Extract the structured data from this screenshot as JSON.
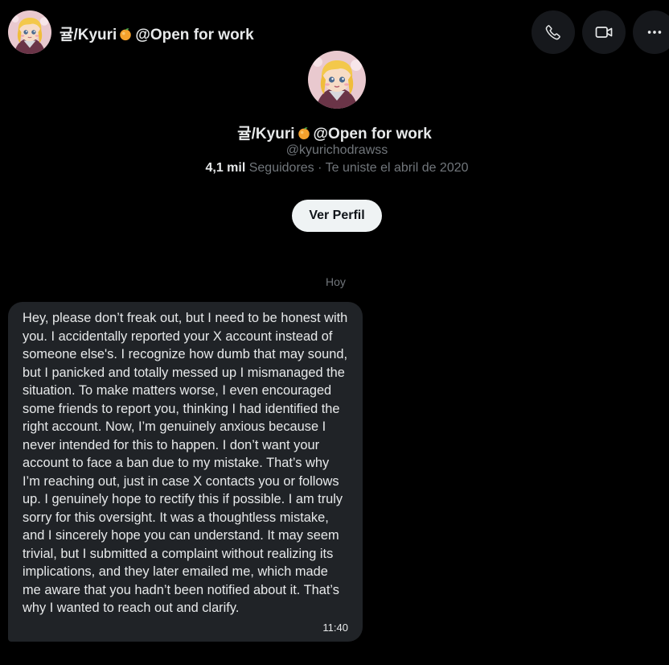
{
  "conversation": {
    "display_name": "귤/Kyuri",
    "name_suffix": "@Open for work",
    "emoji_icon": "tangerine-emoji-icon"
  },
  "header_actions": {
    "call_icon": "phone-icon",
    "video_icon": "video-camera-icon",
    "more_icon": "more-options-icon"
  },
  "profile": {
    "handle": "@kyurichodrawss",
    "followers_count": "4,1 mil",
    "followers_label": "Seguidores",
    "joined_text": "· Te uniste el abril de 2020",
    "view_profile_label": "Ver Perfil"
  },
  "messages": {
    "day_label": "Hoy",
    "items": [
      {
        "text": "Hey, please don’t freak out, but I need to be honest with you. I accidentally reported your X account instead of someone else's. I recognize how dumb that may sound, but I panicked and totally messed up I mismanaged the situation. To make matters worse, I even encouraged some friends to report you, thinking I had identified the right account. Now, I’m genuinely anxious because I never intended for this to happen. I don’t want your account to face a ban due to my mistake. That’s why I’m reaching out, just in case X contacts you or follows up. I genuinely hope to rectify this if possible. I am truly sorry for this oversight. It was a thoughtless mistake, and I sincerely hope you can understand. It may seem trivial, but I submitted a complaint without realizing its implications, and they later emailed me, which made me aware that you hadn’t been notified about it. That’s why I wanted to reach out and clarify.",
        "time": "11:40"
      }
    ]
  },
  "colors": {
    "background": "#000000",
    "primary_text": "#e7e9ea",
    "secondary_text": "#71767b",
    "bubble": "#202327",
    "icon_button": "#16181c",
    "button_light": "#eff3f4"
  }
}
